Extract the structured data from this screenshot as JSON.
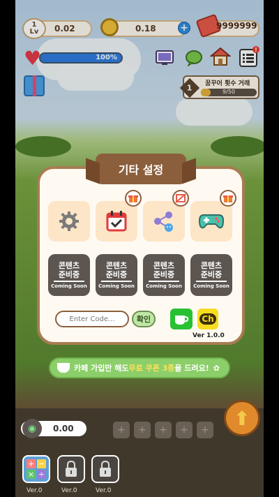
{
  "hud": {
    "level_number": "1",
    "level_label": "Lv",
    "gem_value": "0.02",
    "coin_value": "0.18",
    "ticket_value": "9999999",
    "health_percent_text": "100%",
    "health_fraction": 1.0,
    "notification_mark": "!"
  },
  "quest": {
    "number": "1",
    "title": "꿈꾸어 횟수 거래",
    "progress_text": "9/50",
    "progress_fraction": 0.18
  },
  "modal": {
    "title": "기타 설정",
    "tiles": [
      {
        "icon": "gear-icon",
        "badge": ""
      },
      {
        "icon": "calendar-check-icon",
        "badge": "gift-icon"
      },
      {
        "icon": "share-icon",
        "badge": "no-ads-icon"
      },
      {
        "icon": "gamepad-icon",
        "badge": "gift-icon"
      }
    ],
    "coming_soon": [
      {
        "korean": "콘텐츠\n준비중",
        "english": "Coming Soon"
      },
      {
        "korean": "콘텐츠\n준비중",
        "english": "Coming Soon"
      },
      {
        "korean": "콘텐츠\n준비중",
        "english": "Coming Soon"
      },
      {
        "korean": "콘텐츠\n준비중",
        "english": "Coming Soon"
      }
    ],
    "code_placeholder": "Enter Code...",
    "confirm_label": "확인",
    "kakao_label": "Ch",
    "version": "Ver 1.0.0"
  },
  "banner": {
    "pre": "카페 가입만 해도 ",
    "highlight": "무료 쿠폰 3종",
    "post": "을 드려요!"
  },
  "bottom": {
    "gamepad_value": "0.00",
    "tool_versions": [
      "Ver.0",
      "Ver.0",
      "Ver.0"
    ]
  },
  "colors": {
    "accent_brown": "#8b5e3c",
    "cream": "#fffaf1",
    "banner_green": "#8ccf6a",
    "highlight_yellow": "#ffe15a",
    "cafe_green": "#28c133",
    "kakao_yellow": "#f7dc1f"
  }
}
